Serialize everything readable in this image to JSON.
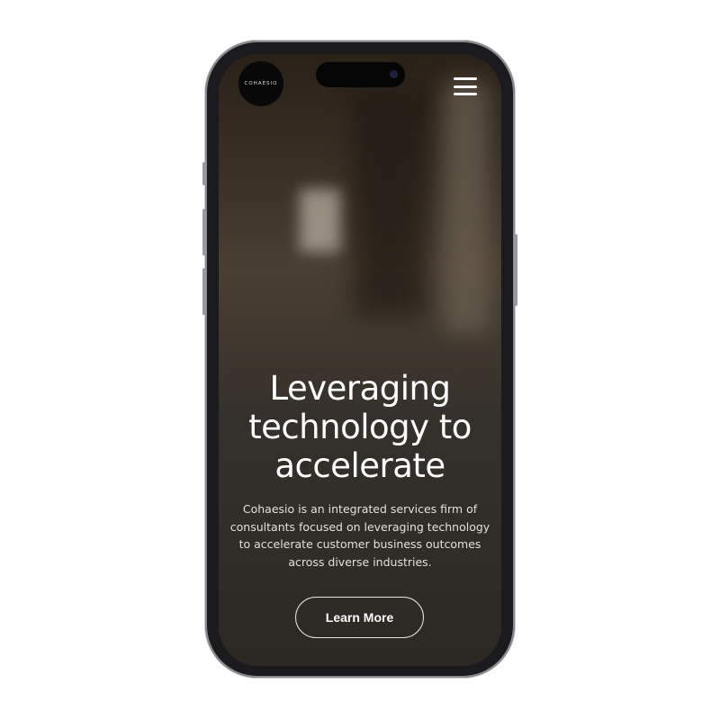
{
  "header": {
    "logo_text": "COHAESIO",
    "menu_icon": "hamburger-icon"
  },
  "hero": {
    "title": "Leveraging technology to accelerate",
    "description": "Cohaesio is an integrated services firm of consultants focused on leveraging technology to accelerate customer business outcomes across diverse industries.",
    "cta_label": "Learn More"
  }
}
